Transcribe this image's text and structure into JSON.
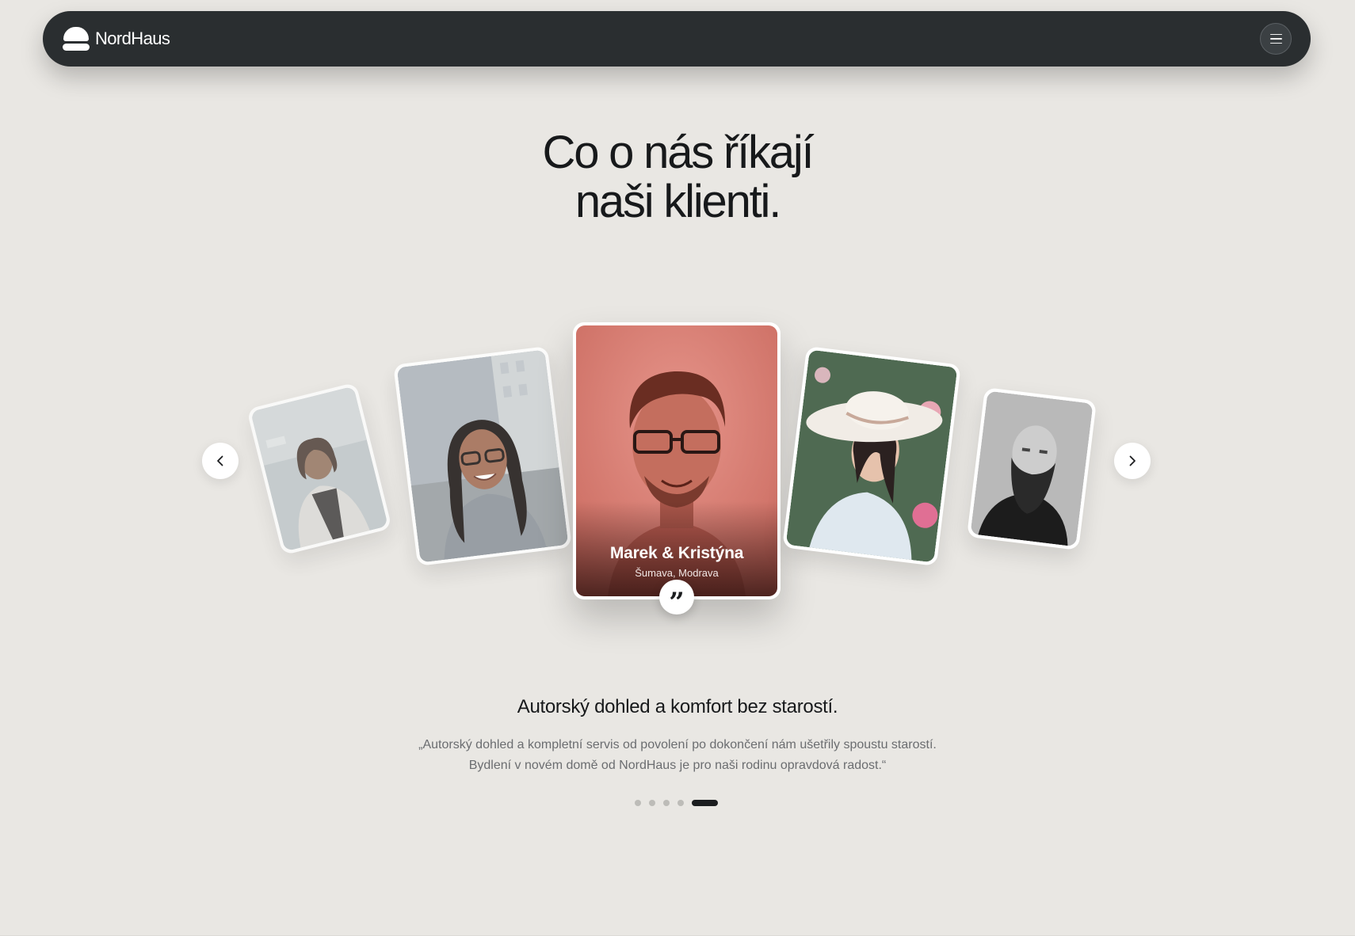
{
  "header": {
    "brand": "NordHaus",
    "menu_icon": "hamburger-icon"
  },
  "heading": {
    "line1": "Co o nás říkají",
    "line2": "naši klienti."
  },
  "carousel": {
    "prev_icon": "chevron-left-icon",
    "next_icon": "chevron-right-icon",
    "active": {
      "name": "Marek & Kristýna",
      "location": "Šumava, Modrava",
      "quote_icon": "quote-icon"
    },
    "active_index": 4,
    "total": 5
  },
  "testimonial": {
    "title": "Autorský dohled a komfort bez starostí.",
    "line1": "„Autorský dohled a kompletní servis od povolení po dokončení nám ušetřily spoustu starostí.",
    "line2": "Bydlení v novém domě od NordHaus je pro naši rodinu opravdová radost.“"
  },
  "colors": {
    "background": "#e9e7e3",
    "navbar": "#2a2e30",
    "text": "#1b1d1f",
    "muted": "#6b6d70"
  }
}
